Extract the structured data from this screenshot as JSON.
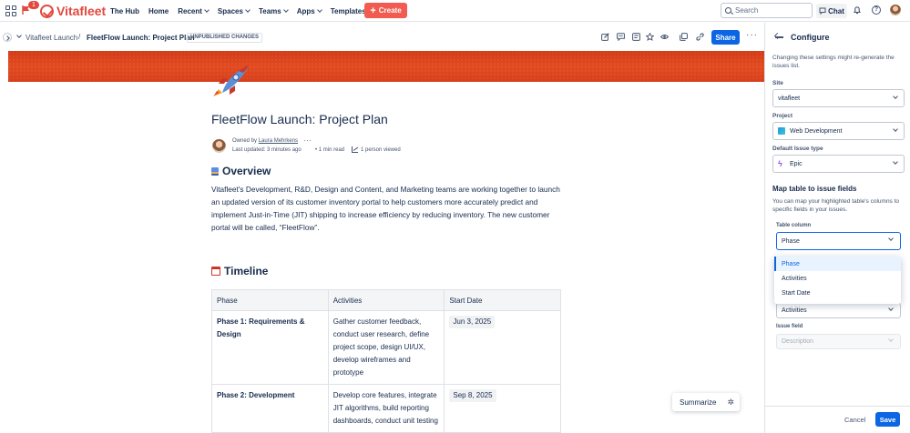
{
  "topnav": {
    "notification_count": "1",
    "brand": "Vitafleet",
    "links": [
      {
        "label": "The Hub",
        "dropdown": false
      },
      {
        "label": "Home",
        "dropdown": false
      },
      {
        "label": "Recent",
        "dropdown": true
      },
      {
        "label": "Spaces",
        "dropdown": true
      },
      {
        "label": "Teams",
        "dropdown": true
      },
      {
        "label": "Apps",
        "dropdown": true
      },
      {
        "label": "Templates",
        "dropdown": false
      }
    ],
    "create_label": "Create",
    "search_placeholder": "Search",
    "chat_label": "Chat",
    "brand_color": "#e2483d"
  },
  "breadcrumb": {
    "space": "Vitafleet Launch",
    "separator": "/",
    "page": "FleetFlow Launch: Project Plan",
    "status_badge": "UNPUBLISHED CHANGES"
  },
  "toolbar": {
    "share_label": "Share",
    "more_label": "···",
    "icons": [
      "edit-icon",
      "comment-icon",
      "inline-comment-icon",
      "star-icon",
      "watch-icon",
      "copy-icon",
      "link-icon"
    ]
  },
  "page": {
    "title": "FleetFlow Launch: Project Plan",
    "owned_prefix": "Owned by",
    "owner": "Laura Mehrkens",
    "byline_more": "···",
    "last_updated": "Last updated: 3 minutes ago",
    "read_time": "• 1 min read",
    "viewed": "1 person viewed",
    "overview_heading": "Overview",
    "overview_text": "Vitafleet's Development, R&D, Design and Content, and Marketing teams are working together to launch an updated version of its customer inventory portal to help customers more accurately predict and implement Just-in-Time (JIT) shipping to increase efficiency by reducing inventory. The new customer portal will be called, “FleetFlow”.",
    "timeline_heading": "Timeline",
    "timeline": {
      "headers": [
        "Phase",
        "Activities",
        "Start Date"
      ],
      "rows": [
        {
          "phase": "Phase 1: Requirements & Design",
          "activities": "Gather customer feedback, conduct user research, define project scope, design UI/UX, develop wireframes and prototype",
          "start": "Jun 3, 2025"
        },
        {
          "phase": "Phase 2: Development",
          "activities": "Develop core features, integrate JIT algorithms, build reporting dashboards, conduct unit testing",
          "start": "Sep 8, 2025"
        }
      ]
    },
    "summarize_label": "Summarize"
  },
  "panel": {
    "title": "Configure",
    "note": "Changing these settings might re-generate the issues list.",
    "site_label": "Site",
    "site_value": "vitafleet",
    "project_label": "Project",
    "project_value": "Web Development",
    "issue_type_label": "Default Issue type",
    "issue_type_value": "Epic",
    "map_title": "Map table to issue fields",
    "map_note": "You can map your highlighted table's columns to specific fields in your issues.",
    "table_column_label": "Table column",
    "table_column_value": "Phase",
    "dropdown_options": [
      "Phase",
      "Activities",
      "Start Date"
    ],
    "selected_option": "Phase",
    "second_column_value": "Activities",
    "issue_field_label": "Issue field",
    "issue_field_placeholder": "Description",
    "cancel_label": "Cancel",
    "save_label": "Save",
    "accent_color": "#0c66e4"
  }
}
